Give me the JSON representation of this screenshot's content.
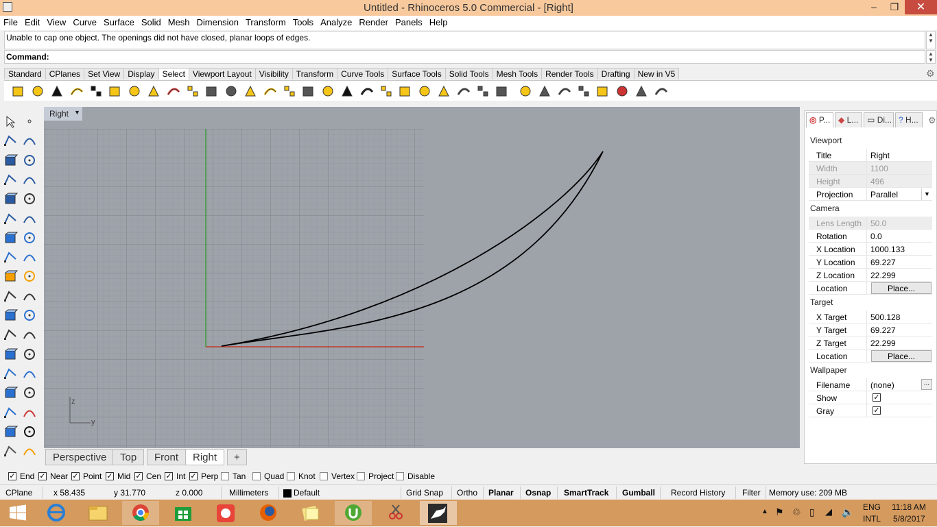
{
  "window": {
    "title": "Untitled - Rhinoceros 5.0 Commercial - [Right]",
    "minimize": "–",
    "maximize": "❐",
    "close": "✕"
  },
  "menu": [
    "File",
    "Edit",
    "View",
    "Curve",
    "Surface",
    "Solid",
    "Mesh",
    "Dimension",
    "Transform",
    "Tools",
    "Analyze",
    "Render",
    "Panels",
    "Help"
  ],
  "command": {
    "message": "Unable to cap one object. The openings did not have closed, planar loops of edges.",
    "prompt": "Command:"
  },
  "toolbar_tabs": [
    "Standard",
    "CPlanes",
    "Set View",
    "Display",
    "Select",
    "Viewport Layout",
    "Visibility",
    "Transform",
    "Curve Tools",
    "Surface Tools",
    "Solid Tools",
    "Mesh Tools",
    "Render Tools",
    "Drafting",
    "New in V5"
  ],
  "active_toolbar_tab": "Select",
  "viewport": {
    "name": "Right",
    "axis_z": "z",
    "axis_y": "y"
  },
  "viewport_tabs": [
    "Perspective",
    "Top",
    "Front",
    "Right"
  ],
  "active_viewport_tab": "Right",
  "viewport_add": "+",
  "panel": {
    "tabs": [
      "P...",
      "L...",
      "Di...",
      "H..."
    ],
    "sections": {
      "viewport": "Viewport",
      "camera": "Camera",
      "target": "Target",
      "wallpaper": "Wallpaper"
    },
    "viewport_rows": [
      {
        "label": "Title",
        "value": "Right"
      },
      {
        "label": "Width",
        "value": "1100"
      },
      {
        "label": "Height",
        "value": "496"
      },
      {
        "label": "Projection",
        "value": "Parallel"
      }
    ],
    "camera_rows": [
      {
        "label": "Lens Length",
        "value": "50.0"
      },
      {
        "label": "Rotation",
        "value": "0.0"
      },
      {
        "label": "X Location",
        "value": "1000.133"
      },
      {
        "label": "Y Location",
        "value": "69.227"
      },
      {
        "label": "Z Location",
        "value": "22.299"
      },
      {
        "label": "Location",
        "value": "Place..."
      }
    ],
    "target_rows": [
      {
        "label": "X Target",
        "value": "500.128"
      },
      {
        "label": "Y Target",
        "value": "69.227"
      },
      {
        "label": "Z Target",
        "value": "22.299"
      },
      {
        "label": "Location",
        "value": "Place..."
      }
    ],
    "wallpaper_rows": [
      {
        "label": "Filename",
        "value": "(none)"
      },
      {
        "label": "Show",
        "value": "✓"
      },
      {
        "label": "Gray",
        "value": "✓"
      }
    ],
    "browse": "..."
  },
  "osnaps": [
    {
      "label": "End",
      "checked": true
    },
    {
      "label": "Near",
      "checked": true
    },
    {
      "label": "Point",
      "checked": true
    },
    {
      "label": "Mid",
      "checked": true
    },
    {
      "label": "Cen",
      "checked": true
    },
    {
      "label": "Int",
      "checked": true
    },
    {
      "label": "Perp",
      "checked": true
    },
    {
      "label": "Tan",
      "checked": false
    },
    {
      "label": "Quad",
      "checked": false
    },
    {
      "label": "Knot",
      "checked": false
    },
    {
      "label": "Vertex",
      "checked": false
    },
    {
      "label": "Project",
      "checked": false
    },
    {
      "label": "Disable",
      "checked": false
    }
  ],
  "status": {
    "cplane": "CPlane",
    "x": "x 58.435",
    "y": "y 31.770",
    "z": "z 0.000",
    "units": "Millimeters",
    "layer": "Default",
    "grid_snap": "Grid Snap",
    "ortho": "Ortho",
    "planar": "Planar",
    "osnap": "Osnap",
    "smarttrack": "SmartTrack",
    "gumball": "Gumball",
    "record_history": "Record History",
    "filter": "Filter",
    "memory": "Memory use: 209 MB"
  },
  "tray": {
    "lang1": "ENG",
    "lang2": "INTL",
    "time": "11:18 AM",
    "date": "5/8/2017"
  },
  "colors": {
    "titlebar": "#f7c99d",
    "taskbar": "#d59a5e",
    "viewport_bg": "#9ea3aa",
    "x_axis": "#c0392b",
    "y_axis": "#3a9b3a"
  }
}
